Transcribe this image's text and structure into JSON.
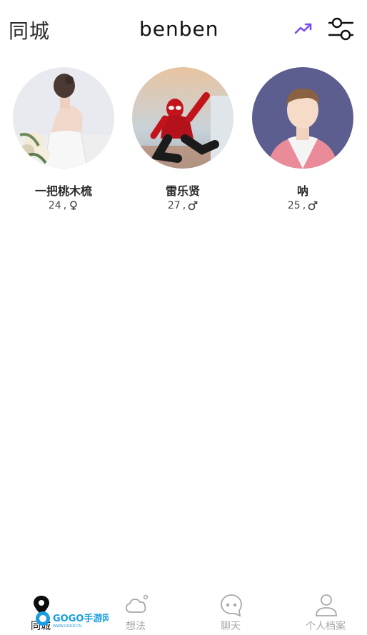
{
  "header": {
    "title": "同城",
    "logo_text": "benben",
    "trend_icon": "trend-up-icon",
    "filter_icon": "sliders-icon",
    "accent_color": "#7b4df0"
  },
  "users": [
    {
      "name": "一把桃木梳",
      "age": "24",
      "separator": ",",
      "gender": "female",
      "gender_icon": "female-icon",
      "avatar": "bride-photo"
    },
    {
      "name": "雷乐贤",
      "age": "27",
      "separator": ",",
      "gender": "male",
      "gender_icon": "male-icon",
      "avatar": "spiderman-photo"
    },
    {
      "name": "呐",
      "age": "25",
      "separator": ",",
      "gender": "male",
      "gender_icon": "male-icon",
      "avatar": "default-avatar"
    }
  ],
  "tabs": [
    {
      "label": "同城",
      "icon": "location-pin-icon",
      "active": true
    },
    {
      "label": "想法",
      "icon": "cloud-icon",
      "active": false
    },
    {
      "label": "聊天",
      "icon": "chat-bubble-icon",
      "active": false
    },
    {
      "label": "个人档案",
      "icon": "person-icon",
      "active": false
    }
  ],
  "watermark": {
    "text": "GOGO手游网",
    "sub": "WWW.GOGO.CN"
  }
}
